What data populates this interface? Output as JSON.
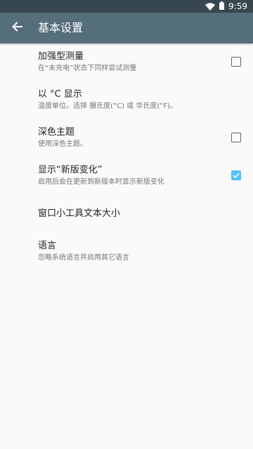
{
  "status_bar": {
    "time": "9:59",
    "icons": [
      "wifi-icon",
      "battery-icon"
    ]
  },
  "app_bar": {
    "title": "基本设置",
    "back_icon": "arrow-back-icon"
  },
  "colors": {
    "status_bar": "#37474f",
    "app_bar": "#546e7a",
    "background": "#fafafa",
    "accent": "#4fc3f7"
  },
  "settings": [
    {
      "title": "加强型测量",
      "summary": "在“未充电”状态下同样尝试测量",
      "has_checkbox": true,
      "checked": false
    },
    {
      "title": "以 °C 显示",
      "summary": "温度单位。选择 摄氏度(°C) 或 华氏度(°F)。",
      "has_checkbox": false
    },
    {
      "title": "深色主题",
      "summary": "使用深色主题。",
      "has_checkbox": true,
      "checked": false
    },
    {
      "title": "显示“新版变化”",
      "summary": "启用后会在更新到新版本时显示新版变化",
      "has_checkbox": true,
      "checked": true
    },
    {
      "title": "窗口小工具文本大小",
      "summary": "",
      "has_checkbox": false
    },
    {
      "title": "语言",
      "summary": "忽略系统语言并启用其它语言",
      "has_checkbox": false
    }
  ]
}
